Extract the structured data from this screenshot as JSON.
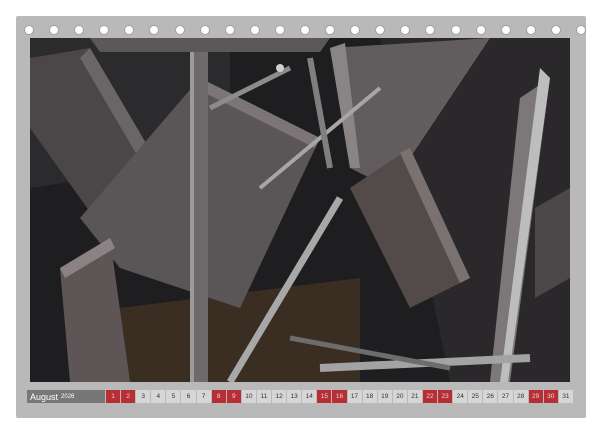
{
  "calendar": {
    "month": "August",
    "year": "2026",
    "days": [
      "1",
      "2",
      "3",
      "4",
      "5",
      "6",
      "7",
      "8",
      "9",
      "10",
      "11",
      "12",
      "13",
      "14",
      "15",
      "16",
      "17",
      "18",
      "19",
      "20",
      "21",
      "22",
      "23",
      "24",
      "25",
      "26",
      "27",
      "28",
      "29",
      "30",
      "31"
    ],
    "weekend_indices": [
      0,
      1,
      7,
      8,
      14,
      15,
      21,
      22,
      28,
      29
    ],
    "weekend_color": "#b82e35"
  },
  "photo": {
    "subject": "steel-scrap-collage",
    "accent_colors": [
      "#1e1d1f",
      "#4d4a4d",
      "#6f6a6a",
      "#9c9c9c"
    ]
  },
  "binding": {
    "ring_count": 23
  }
}
